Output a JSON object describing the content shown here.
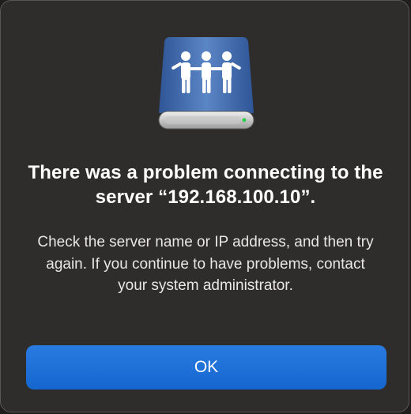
{
  "dialog": {
    "title": "There was a problem connecting to the server “192.168.100.10”.",
    "message": "Check the server name or IP address, and then try again. If you continue to have problems, contact your system administrator.",
    "ok_label": "OK",
    "icon": "shared-server-drive-icon"
  },
  "colors": {
    "dialog_background": "#2f2d2b",
    "button_accent": "#1c6fd6",
    "drive_body": "#4a72b2"
  }
}
